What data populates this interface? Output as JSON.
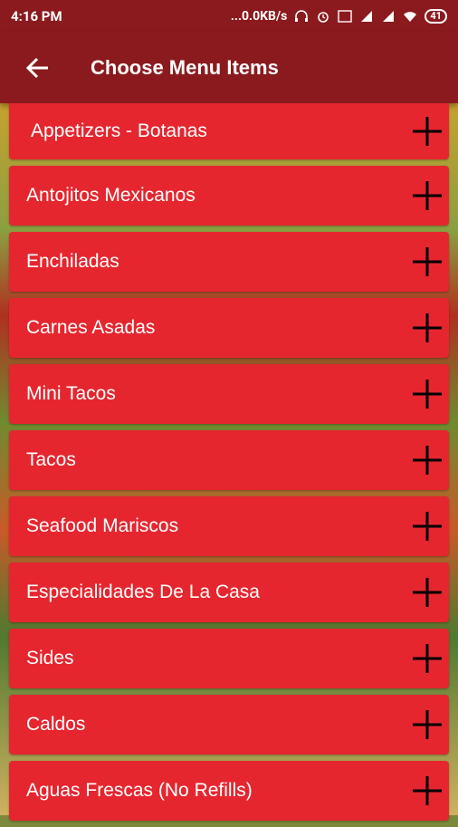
{
  "status_bar": {
    "time": "4:16 PM",
    "net_speed": "...0.0KB/s",
    "battery": "41"
  },
  "app_bar": {
    "title": "Choose Menu Items"
  },
  "menu": {
    "items": [
      {
        "label": "Appetizers - Botanas"
      },
      {
        "label": "Antojitos Mexicanos"
      },
      {
        "label": "Enchiladas"
      },
      {
        "label": "Carnes Asadas"
      },
      {
        "label": "Mini Tacos"
      },
      {
        "label": "Tacos"
      },
      {
        "label": "Seafood Mariscos"
      },
      {
        "label": "Especialidades De La Casa"
      },
      {
        "label": "Sides"
      },
      {
        "label": "Caldos"
      },
      {
        "label": "Aguas Frescas (No Refills)"
      }
    ]
  },
  "colors": {
    "app_bar": "#8b1a1e",
    "item_bg": "#e5262f"
  }
}
